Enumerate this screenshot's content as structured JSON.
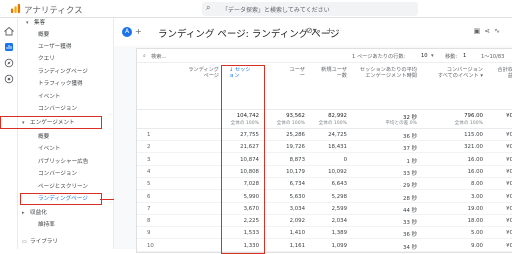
{
  "app": {
    "title": "アナリティクス"
  },
  "search": {
    "placeholder": "「データ探索」と検索してみてください"
  },
  "nav": {
    "top_header": "集客",
    "acquisition_items": [
      "概要",
      "ユーザー獲得",
      "クエリ",
      "ランディングページ",
      "トラフィック獲得",
      "イベント",
      "コンバージョン"
    ],
    "engagement_header": "エンゲージメント",
    "engagement_items": [
      "概要",
      "イベント",
      "パブリッシャー広告",
      "コンバージョン",
      "ページとスクリーン",
      "ランディングページ"
    ],
    "monetization_header": "収益化",
    "retention_label": "維持率",
    "library_label": "ライブラリ"
  },
  "report": {
    "badge": "A",
    "title": "ランディング ページ: ランディング ページ",
    "check_icon": "check-circle-icon",
    "search_label": "検索...",
    "rows_per_page_label": "1 ページあたりの行数:",
    "rows_per_page": "10",
    "goto_label": "移動:",
    "goto_value": "1",
    "pagination": "1～10/83"
  },
  "table": {
    "columns": [
      {
        "label": "ランディング\nページ",
        "sub": ""
      },
      {
        "label": "↓ セッシ\nョン",
        "sub": ""
      },
      {
        "label": "ユーザ\nー",
        "sub": ""
      },
      {
        "label": "新規ユーザ\nー数",
        "sub": ""
      },
      {
        "label": "セッションあたりの平均\nエンゲージメント時間",
        "sub": ""
      },
      {
        "label": "コンバージョン\nすべてのイベント ▾",
        "sub": ""
      },
      {
        "label": "合計収\n益",
        "sub": ""
      }
    ],
    "totals": [
      {
        "value": "104,742",
        "sub": "全体の 100%"
      },
      {
        "value": "93,562",
        "sub": "全体の 100%"
      },
      {
        "value": "82,992",
        "sub": "全体の 100%"
      },
      {
        "value": "32 秒",
        "sub": "平均との差 0%"
      },
      {
        "value": "796.00",
        "sub": "全体の 100%"
      },
      {
        "value": "¥0",
        "sub": ""
      }
    ],
    "rows": [
      {
        "n": "1",
        "sessions": "27,755",
        "users": "25,286",
        "new_users": "24,725",
        "engagement": "36 秒",
        "conversions": "115.00",
        "revenue": "¥0"
      },
      {
        "n": "2",
        "sessions": "21,627",
        "users": "19,726",
        "new_users": "18,431",
        "engagement": "37 秒",
        "conversions": "321.00",
        "revenue": "¥0"
      },
      {
        "n": "3",
        "sessions": "10,874",
        "users": "8,873",
        "new_users": "0",
        "engagement": "1 秒",
        "conversions": "16.00",
        "revenue": "¥0"
      },
      {
        "n": "4",
        "sessions": "10,808",
        "users": "10,179",
        "new_users": "10,092",
        "engagement": "33 秒",
        "conversions": "16.00",
        "revenue": "¥0"
      },
      {
        "n": "5",
        "sessions": "7,028",
        "users": "6,734",
        "new_users": "6,643",
        "engagement": "29 秒",
        "conversions": "8.00",
        "revenue": "¥0"
      },
      {
        "n": "6",
        "sessions": "5,990",
        "users": "5,630",
        "new_users": "5,298",
        "engagement": "28 秒",
        "conversions": "3.00",
        "revenue": "¥0"
      },
      {
        "n": "7",
        "sessions": "3,670",
        "users": "3,034",
        "new_users": "2,599",
        "engagement": "44 秒",
        "conversions": "19.00",
        "revenue": "¥0"
      },
      {
        "n": "8",
        "sessions": "2,225",
        "users": "2,092",
        "new_users": "2,034",
        "engagement": "33 秒",
        "conversions": "18.00",
        "revenue": "¥0"
      },
      {
        "n": "9",
        "sessions": "1,533",
        "users": "1,410",
        "new_users": "1,389",
        "engagement": "36 秒",
        "conversions": "5.00",
        "revenue": "¥0"
      },
      {
        "n": "10",
        "sessions": "1,330",
        "users": "1,161",
        "new_users": "1,099",
        "engagement": "34 秒",
        "conversions": "9.00",
        "revenue": "¥0"
      }
    ]
  },
  "colors": {
    "accent": "#1a73e8",
    "highlight": "#d93025"
  }
}
